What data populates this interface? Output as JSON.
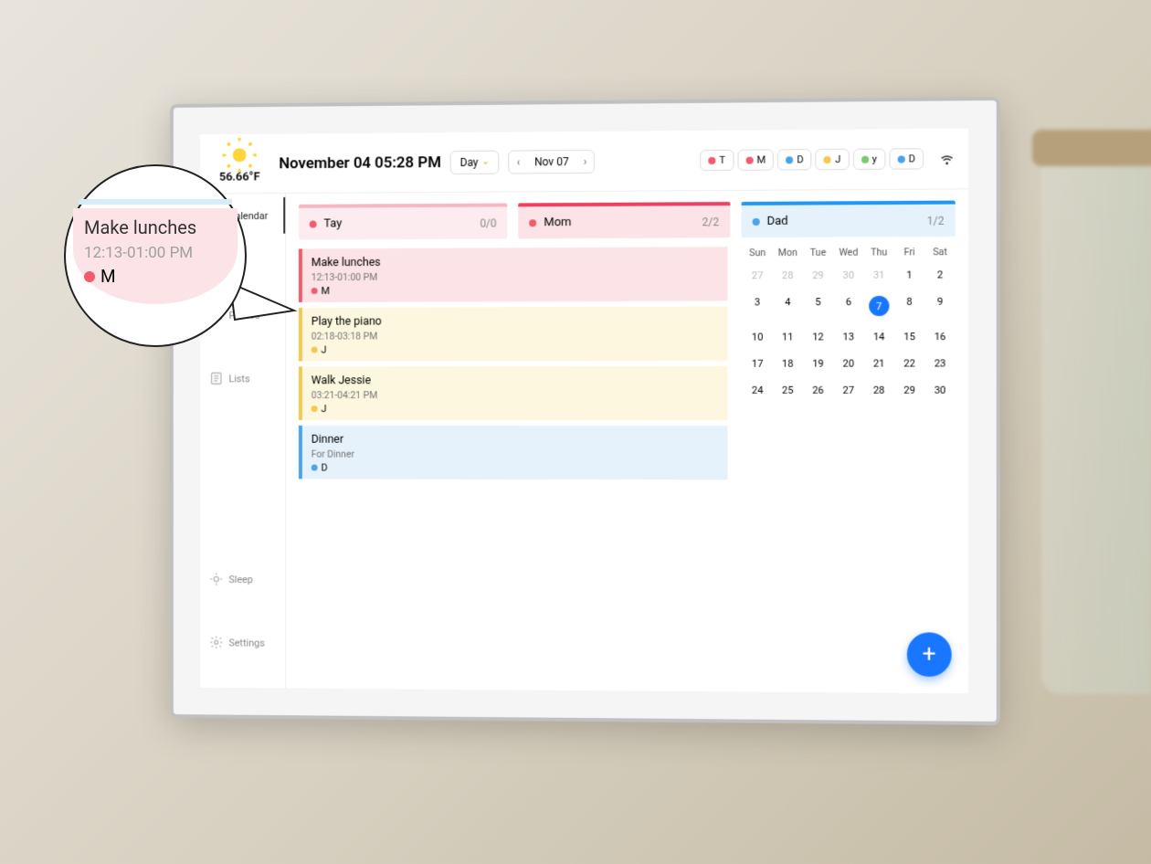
{
  "weather": {
    "temperature": "56.66°F"
  },
  "datetime": "November 04  05:28 PM",
  "range_label": "Day",
  "date_nav": {
    "label": "Nov 07"
  },
  "people": [
    {
      "initial": "T",
      "color": "#f15b6c"
    },
    {
      "initial": "M",
      "color": "#f15b6c"
    },
    {
      "initial": "D",
      "color": "#4aa3e8"
    },
    {
      "initial": "J",
      "color": "#f2c94c"
    },
    {
      "initial": "y",
      "color": "#7bc96f"
    },
    {
      "initial": "D",
      "color": "#4aa3e8"
    }
  ],
  "sidebar": {
    "calendar": "Calendar",
    "photos": "Photos",
    "lists": "Lists",
    "sleep": "Sleep",
    "settings": "Settings"
  },
  "members": [
    {
      "name": "Tay",
      "count": "0/0",
      "dot": "#f15b6c",
      "bar": "#f7b7c2",
      "bg": "#fcecef"
    },
    {
      "name": "Mom",
      "count": "2/2",
      "dot": "#f15b6c",
      "bar": "#ee4060",
      "bg": "#fbe3e7"
    },
    {
      "name": "Dad",
      "count": "1/2",
      "dot": "#4aa3e8",
      "bar": "#2196f3",
      "bg": "#e6f2fb"
    }
  ],
  "events": [
    {
      "title": "Make lunches",
      "time": "12:13-01:00 PM",
      "person": "M",
      "dot": "#f15b6c",
      "bar": "#f15b6c",
      "bg": "#fbe3e7"
    },
    {
      "title": "Play the piano",
      "time": "02:18-03:18 PM",
      "person": "J",
      "dot": "#f2c94c",
      "bar": "#f2c94c",
      "bg": "#fdf7df"
    },
    {
      "title": "Walk Jessie",
      "time": "03:21-04:21 PM",
      "person": "J",
      "dot": "#f2c94c",
      "bar": "#f2c94c",
      "bg": "#fdf7df"
    },
    {
      "title": "Dinner",
      "time": "For Dinner",
      "person": "D",
      "dot": "#4aa3e8",
      "bar": "#4aa3e8",
      "bg": "#e6f2fb"
    }
  ],
  "calendar": {
    "weekdays": [
      "Sun",
      "Mon",
      "Tue",
      "Wed",
      "Thu",
      "Fri",
      "Sat"
    ],
    "selected": 7,
    "days": [
      {
        "n": 27,
        "m": true
      },
      {
        "n": 28,
        "m": true
      },
      {
        "n": 29,
        "m": true
      },
      {
        "n": 30,
        "m": true
      },
      {
        "n": 31,
        "m": true
      },
      {
        "n": 1
      },
      {
        "n": 2
      },
      {
        "n": 3
      },
      {
        "n": 4
      },
      {
        "n": 5
      },
      {
        "n": 6
      },
      {
        "n": 7
      },
      {
        "n": 8
      },
      {
        "n": 9
      },
      {
        "n": 10
      },
      {
        "n": 11
      },
      {
        "n": 12
      },
      {
        "n": 13
      },
      {
        "n": 14
      },
      {
        "n": 15
      },
      {
        "n": 16
      },
      {
        "n": 17
      },
      {
        "n": 18
      },
      {
        "n": 19
      },
      {
        "n": 20
      },
      {
        "n": 21
      },
      {
        "n": 22
      },
      {
        "n": 23
      },
      {
        "n": 24
      },
      {
        "n": 25
      },
      {
        "n": 26
      },
      {
        "n": 27
      },
      {
        "n": 28
      },
      {
        "n": 29
      },
      {
        "n": 30
      }
    ]
  },
  "callout": {
    "title": "Make lunches",
    "time": "12:13-01:00 PM",
    "person": "M"
  }
}
